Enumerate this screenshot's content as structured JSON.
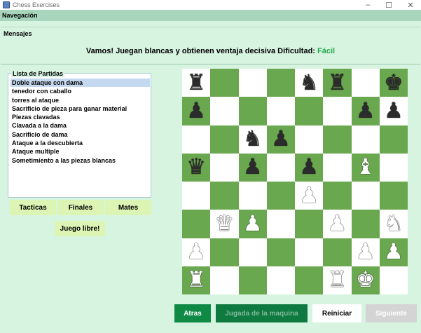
{
  "window": {
    "title": "Chess Exercises",
    "minimize": "–",
    "maximize": "☐",
    "close": "✕"
  },
  "menu": {
    "navigation": "Navegación"
  },
  "messages": {
    "legend": "Mensajes",
    "text": "Vamos! Juegan blancas y obtienen ventaja decisiva Dificultad: ",
    "difficulty": "Fácil",
    "difficulty_color": "#23a84a"
  },
  "games": {
    "legend": "Lista de Partidas",
    "selected_index": 0,
    "items": [
      "Doble ataque con dama",
      "tenedor con caballo",
      "torres al ataque",
      "Sacrificio de pieza para ganar material",
      "Piezas clavadas",
      "Clavada a la dama",
      "Sacrificio de dama",
      "Ataque a la descubierta",
      "Ataque multiple",
      "Sometimiento a las piezas blancas"
    ]
  },
  "categories": {
    "tactics": "Tacticas",
    "endings": "Finales",
    "mates": "Mates",
    "free_play": "Juego libre!"
  },
  "board": {
    "light_color": "#ffffff",
    "dark_color": "#6aa84f",
    "rows": [
      [
        "br",
        "",
        "",
        "",
        "bn",
        "br",
        "",
        "bk"
      ],
      [
        "bp",
        "",
        "",
        "",
        "",
        "",
        "bp",
        "bp"
      ],
      [
        "",
        "",
        "bn",
        "bp",
        "",
        "",
        "",
        ""
      ],
      [
        "bq",
        "",
        "bp",
        "",
        "bp",
        "",
        "wb",
        ""
      ],
      [
        "",
        "",
        "",
        "",
        "wp",
        "",
        "",
        ""
      ],
      [
        "",
        "wq",
        "wp",
        "",
        "",
        "wp",
        "",
        "wn"
      ],
      [
        "wp",
        "",
        "",
        "",
        "",
        "",
        "wp",
        "wp"
      ],
      [
        "wr",
        "",
        "",
        "",
        "",
        "wr",
        "wk",
        ""
      ]
    ]
  },
  "controls": {
    "back": "Atras",
    "machine_move": "Jugada de la maquina",
    "restart": "Reiniciar",
    "next": "Siguiente"
  }
}
